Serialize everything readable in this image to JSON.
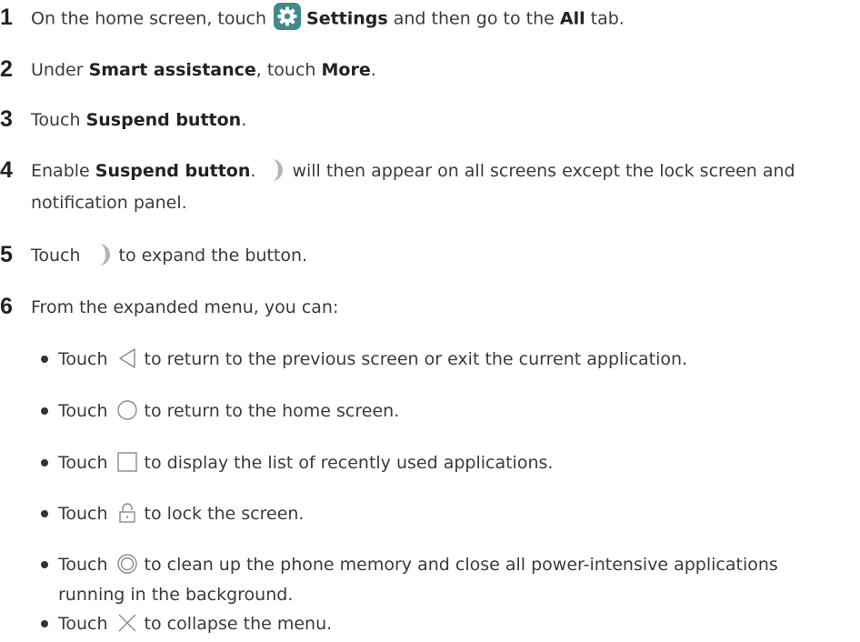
{
  "steps": [
    {
      "num": "1",
      "pre": "On the home screen, touch",
      "icon": "settings-icon",
      "b1": "Settings",
      "mid": " and then go to the ",
      "b2": "All",
      "post": " tab."
    },
    {
      "num": "2",
      "pre": "Under ",
      "b1": "Smart assistance",
      "mid": ", touch ",
      "b2": "More",
      "post": "."
    },
    {
      "num": "3",
      "pre": "Touch ",
      "b1": "Suspend button",
      "post": "."
    },
    {
      "num": "4",
      "pre": "Enable ",
      "b1": "Suspend button",
      "post": ".",
      "icon": "suspend-button-icon",
      "after": "will then appear on all screens except the lock screen and",
      "line2": "notification panel."
    },
    {
      "num": "5",
      "pre": "Touch",
      "icon": "suspend-button-icon",
      "after": "to expand the button."
    },
    {
      "num": "6",
      "pre": "From the expanded menu, you can:"
    }
  ],
  "bullets": [
    {
      "pre": "Touch",
      "icon": "back-icon",
      "text": "to return to the previous screen or exit the current application."
    },
    {
      "pre": "Touch",
      "icon": "home-icon",
      "text": "to return to the home screen."
    },
    {
      "pre": "Touch",
      "icon": "recent-apps-icon",
      "text": "to display the list of recently used applications."
    },
    {
      "pre": "Touch",
      "icon": "lock-icon",
      "text": "to lock the screen."
    },
    {
      "pre": "Touch",
      "icon": "clean-up-icon",
      "text": "to clean up the phone memory and close all power-intensive applications",
      "line2": "running in the background."
    },
    {
      "pre": "Touch",
      "icon": "close-icon",
      "text": "to collapse the menu."
    }
  ],
  "colors": {
    "text": "#3a3a3a",
    "settings_icon_bg": "#3f8a8c",
    "suspend_icon": "#b4b4b4",
    "symbol_stroke": "#8a8a8a"
  }
}
